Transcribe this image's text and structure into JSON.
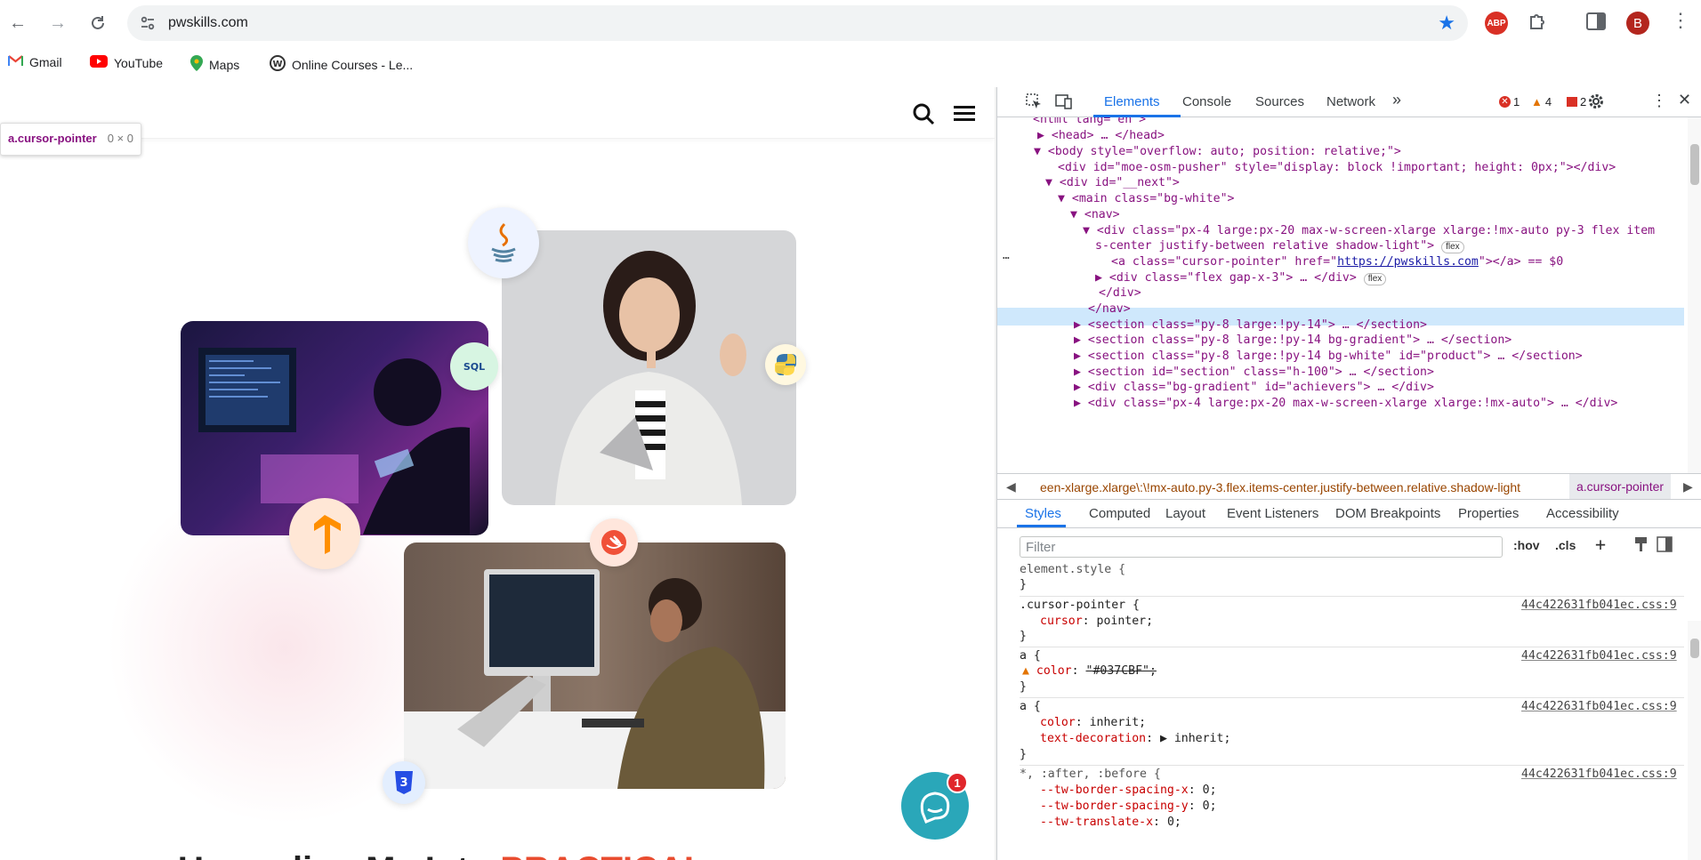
{
  "browser": {
    "url": "pwskills.com",
    "bookmarks": [
      "Gmail",
      "YouTube",
      "Maps",
      "Online Courses - Le..."
    ],
    "profile_initial": "B",
    "extension_label": "ABP"
  },
  "page": {
    "tooltip_selector": "a.cursor-pointer",
    "tooltip_size": "0 × 0",
    "headline_prefix": "Upgrading Me Into",
    "headline_highlight": "PRACTICAL",
    "chat_count": "1",
    "badges": {
      "sql": "SQL",
      "css": "3"
    }
  },
  "devtools": {
    "tabs": [
      "Elements",
      "Console",
      "Sources",
      "Network"
    ],
    "more_tabs": "»",
    "errors": "1",
    "warnings": "4",
    "issues": "2",
    "dom": [
      "<html lang=\"en\">",
      "▶ <head> … </head>",
      "▼ <body style=\"overflow: auto; position: relative;\">",
      "<div id=\"moe-osm-pusher\" style=\"display: block !important; height: 0px;\"></div>",
      "▼ <div id=\"__next\">",
      "▼ <main class=\"bg-white\">",
      "▼ <nav>",
      "▼ <div class=\"px-4 large:px-20 max-w-screen-xlarge xlarge:!mx-auto py-3 flex item",
      "s-center justify-between relative shadow-light\">",
      "<a class=\"cursor-pointer\" href=\"https://pwskills.com\"></a> == $0",
      "▶ <div class=\"flex gap-x-3\"> … </div>",
      "</div>",
      "</nav>",
      "▶ <section class=\"py-8 large:!py-14\"> … </section>",
      "▶ <section class=\"py-8 large:!py-14 bg-gradient\"> … </section>",
      "▶ <section class=\"py-8 large:!py-14 bg-white\" id=\"product\"> … </section>",
      "▶ <section id=\"section\" class=\"h-100\"> … </section>",
      "▶ <div class=\"bg-gradient\" id=\"achievers\"> … </div>",
      "▶ <div class=\"px-4 large:px-20 max-w-screen-xlarge xlarge:!mx-auto\"> … </div>"
    ],
    "flex_pill": "flex",
    "selected_href": "https://pwskills.com",
    "breadcrumb_left": "een-xlarge.xlarge\\:\\!mx-auto.py-3.flex.items-center.justify-between.relative.shadow-light",
    "breadcrumb_current": "a.cursor-pointer",
    "style_tabs": [
      "Styles",
      "Computed",
      "Layout",
      "Event Listeners",
      "DOM Breakpoints",
      "Properties",
      "Accessibility"
    ],
    "filter_placeholder": "Filter",
    "hov": ":hov",
    "cls": ".cls",
    "css_source": "44c422631fb041ec.css:9",
    "rules": [
      {
        "selector": "element.style {",
        "decls": []
      },
      {
        "selector": ".cursor-pointer {",
        "decls": [
          {
            "p": "cursor",
            "v": "pointer;"
          }
        ]
      },
      {
        "selector": "a {",
        "decls": [
          {
            "p": "color",
            "v": "\"#037CBF\";"
          }
        ]
      },
      {
        "selector": "a {",
        "decls": [
          {
            "p": "color",
            "v": "inherit;"
          },
          {
            "p": "text-decoration",
            "v": "▶ inherit;"
          }
        ]
      },
      {
        "selector": "*, :after, :before {",
        "decls": [
          {
            "p": "--tw-border-spacing-x",
            "v": "0;"
          },
          {
            "p": "--tw-border-spacing-y",
            "v": "0;"
          },
          {
            "p": "--tw-translate-x",
            "v": "0;"
          }
        ]
      }
    ]
  },
  "colors": {
    "accent": "#1a73e8",
    "chat": "#2aa7b9",
    "highlight": "#e94c2f"
  }
}
